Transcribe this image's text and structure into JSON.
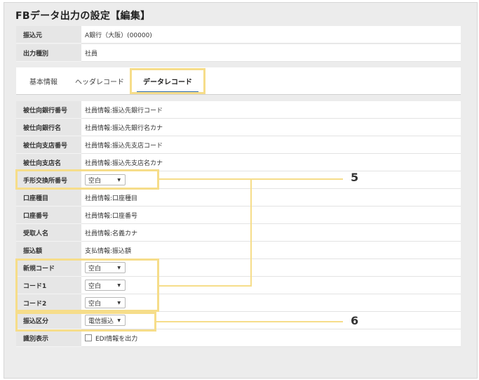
{
  "page": {
    "title": "FBデータ出力の設定【編集】"
  },
  "header_fields": [
    {
      "label": "振込元",
      "value": "A銀行（大阪）(00000)"
    },
    {
      "label": "出力種別",
      "value": "社員"
    }
  ],
  "tabs": [
    {
      "label": "基本情報"
    },
    {
      "label": "ヘッダレコード"
    },
    {
      "label": "データレコード"
    }
  ],
  "records": [
    {
      "label": "被仕向銀行番号",
      "value": "社員情報:振込先銀行コード"
    },
    {
      "label": "被仕向銀行名",
      "value": "社員情報:振込先銀行名カナ"
    },
    {
      "label": "被仕向支店番号",
      "value": "社員情報:振込先支店コード"
    },
    {
      "label": "被仕向支店名",
      "value": "社員情報:振込先支店名カナ"
    },
    {
      "label": "手形交換所番号",
      "select": "空白"
    },
    {
      "label": "口座種目",
      "value": "社員情報:口座種目"
    },
    {
      "label": "口座番号",
      "value": "社員情報:口座番号"
    },
    {
      "label": "受取人名",
      "value": "社員情報:名義カナ"
    },
    {
      "label": "振込額",
      "value": "支払情報:振込額"
    },
    {
      "label": "新規コード",
      "select": "空白"
    },
    {
      "label": "コード1",
      "select": "空白"
    },
    {
      "label": "コード2",
      "select": "空白"
    },
    {
      "label": "振込区分",
      "select": "電信振込"
    },
    {
      "label": "識別表示",
      "checkbox_label": "EDI情報を出力"
    }
  ],
  "callouts": {
    "first": "5",
    "second": "6"
  },
  "colors": {
    "highlight": "#f6dd8a",
    "active_tab_underline": "#2b6cb0"
  }
}
